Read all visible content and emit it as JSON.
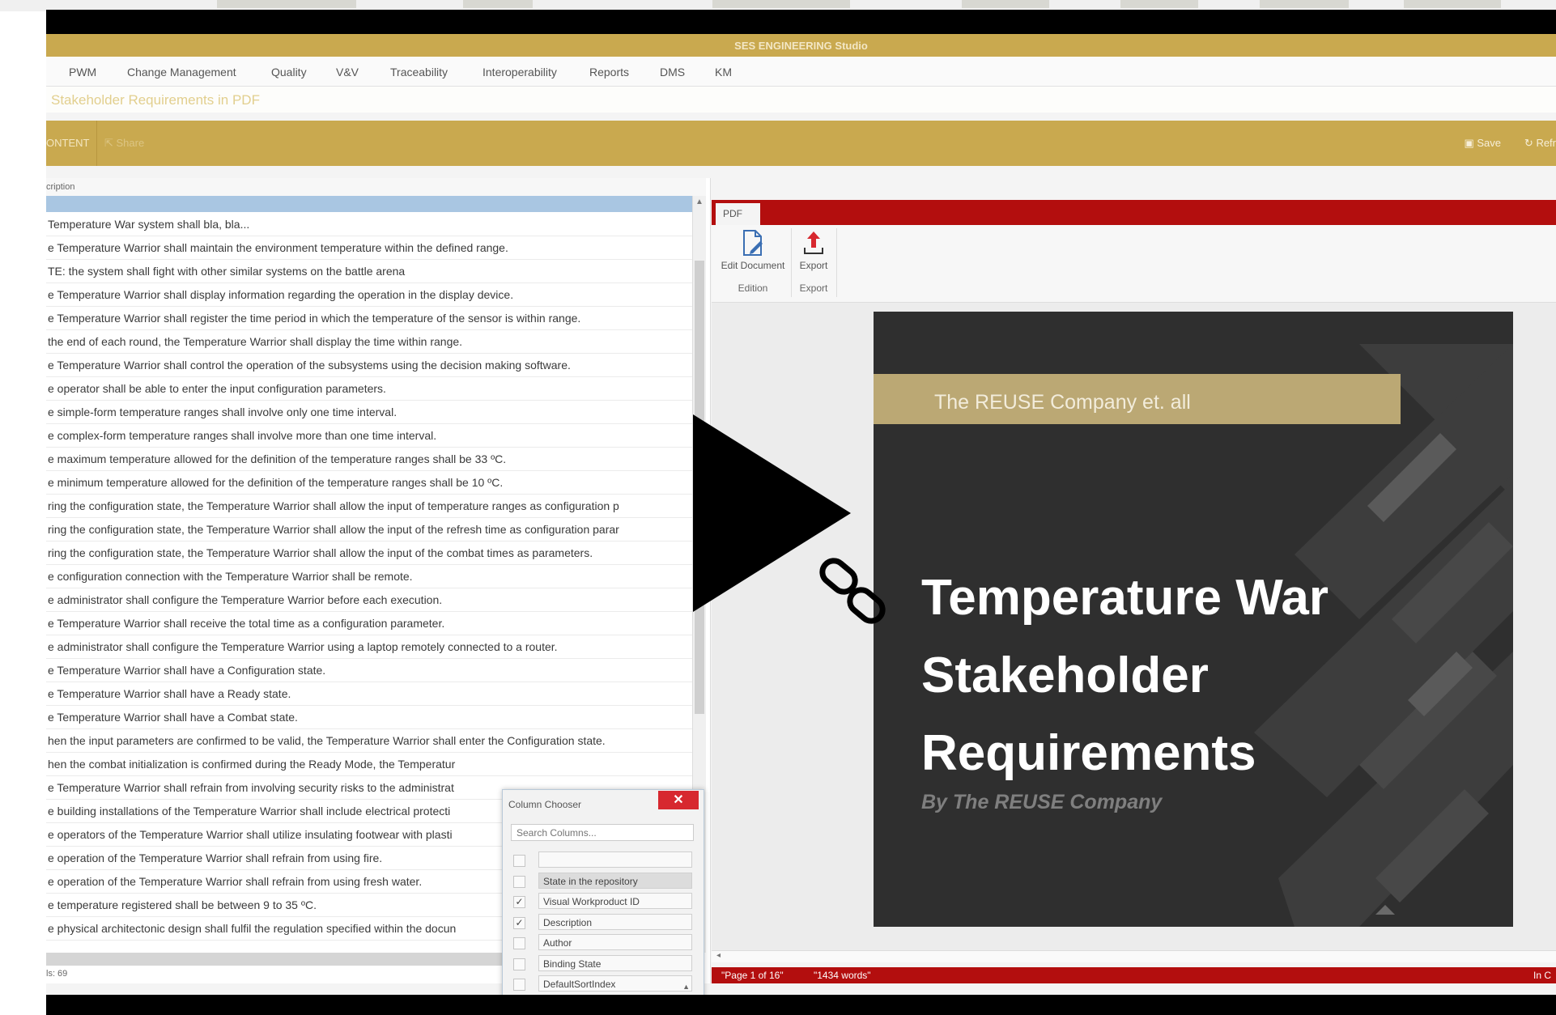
{
  "window": {
    "title": "SES ENGINEERING Studio"
  },
  "menu": {
    "items": [
      "PWM",
      "Change Management",
      "Quality",
      "V&V",
      "Traceability",
      "Interoperability",
      "Reports",
      "DMS",
      "KM"
    ]
  },
  "page": {
    "heading": "Stakeholder Requirements in PDF"
  },
  "ribbon": {
    "content_label": "ONTENT",
    "share_label": "Share",
    "save_label": "Save",
    "refresh_label": "Refr"
  },
  "grid": {
    "column_header": "cription",
    "footer_count": "ls: 69",
    "rows": [
      "Temperature War system shall bla, bla...",
      "e Temperature Warrior shall maintain the environment temperature within the defined range.",
      "TE: the system shall fight with other similar systems on the battle arena",
      "e Temperature Warrior shall display information regarding the operation in the display device.",
      "e Temperature Warrior shall register the time period in which the temperature of the sensor is within range.",
      "the end of each round, the Temperature Warrior shall display the time within range.",
      "e Temperature Warrior shall control the operation of the subsystems using the decision making software.",
      "e operator shall be able to enter the input configuration parameters.",
      "e simple-form temperature ranges shall involve only one time interval.",
      "e complex-form temperature ranges shall involve more than one time interval.",
      "e maximum temperature allowed for the definition of the temperature ranges shall be 33 ºC.",
      "e minimum temperature allowed for the definition of the temperature ranges shall be 10 ºC.",
      "ring the configuration state, the Temperature Warrior shall allow the input of temperature ranges as configuration p",
      "ring the configuration state, the Temperature Warrior shall allow the input of the refresh time as configuration parar",
      "ring the configuration state, the Temperature Warrior shall allow the input of the combat times as parameters.",
      "e configuration connection with the Temperature Warrior shall be remote.",
      "e administrator shall configure the Temperature Warrior before each execution.",
      "e Temperature Warrior shall receive the total time as a configuration parameter.",
      "e administrator shall configure the Temperature Warrior using a laptop remotely connected to a router.",
      "e Temperature Warrior shall have a Configuration state.",
      "e Temperature Warrior shall have a Ready state.",
      "e Temperature Warrior shall have a Combat state.",
      "hen the input parameters are confirmed to be valid, the Temperature Warrior shall enter the Configuration state.",
      "hen the combat initialization is confirmed during the Ready Mode, the Temperatur",
      "e Temperature Warrior shall refrain from involving security risks to the administrat",
      "e building installations of the Temperature Warrior shall include electrical protecti",
      "e operators of the Temperature Warrior shall utilize insulating footwear with plasti",
      "e operation of the Temperature Warrior shall refrain from using fire.",
      "e operation of the Temperature Warrior shall refrain from using fresh water.",
      "e temperature registered shall be between 9 to 35 ºC.",
      "e physical architectonic design shall fulfil the regulation specified within the docun"
    ]
  },
  "column_chooser": {
    "title": "Column Chooser",
    "close_symbol": "✕",
    "search_placeholder": "Search Columns...",
    "columns": [
      {
        "label": "",
        "checked": false
      },
      {
        "label": "State in the repository",
        "checked": false
      },
      {
        "label": "Visual Workproduct ID",
        "checked": true
      },
      {
        "label": "Description",
        "checked": true
      },
      {
        "label": "Author",
        "checked": false
      },
      {
        "label": "Binding State",
        "checked": false
      },
      {
        "label": "DefaultSortIndex",
        "checked": false
      }
    ]
  },
  "pdf": {
    "tab_label": "PDF",
    "toolbar": {
      "edit_document": "Edit Document",
      "export": "Export",
      "group_edition": "Edition",
      "group_export": "Export"
    },
    "document": {
      "band_text": "The REUSE Company et. all",
      "title_lines": [
        "Temperature War",
        "Stakeholder",
        "Requirements"
      ],
      "byline": "By The REUSE Company"
    },
    "status": {
      "page": "\"Page 1 of 16\"",
      "words": "\"1434 words\"",
      "right": "In C"
    }
  },
  "colors": {
    "accent_gold": "#c9a94f",
    "pdf_red": "#b30e0e",
    "selection_blue": "#a9c6e2"
  },
  "icons": {
    "play": "play-icon",
    "link": "link-icon",
    "edit": "edit-document-icon",
    "export": "export-upload-icon"
  }
}
